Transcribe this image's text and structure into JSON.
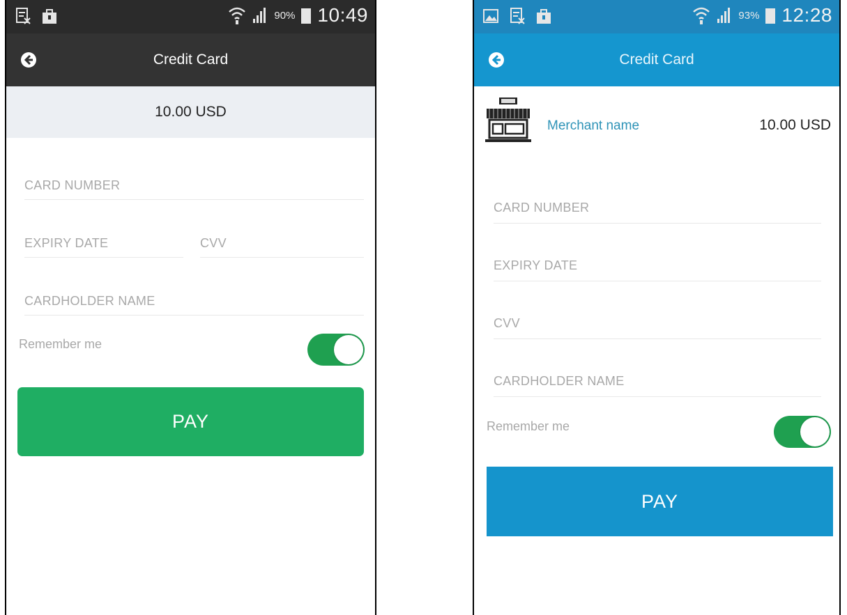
{
  "screen_left": {
    "status": {
      "battery_pct": "90%",
      "time": "10:49"
    },
    "appbar_title": "Credit Card",
    "amount": "10.00 USD",
    "fields": {
      "card_number": "CARD NUMBER",
      "expiry_date": "EXPIRY DATE",
      "cvv": "CVV",
      "cardholder_name": "CARDHOLDER NAME"
    },
    "remember_label": "Remember me",
    "remember_on": true,
    "pay_label": "PAY",
    "colors": {
      "appbar": "#333333",
      "pay": "#1fae63",
      "toggle": "#1fa050"
    }
  },
  "screen_right": {
    "status": {
      "battery_pct": "93%",
      "time": "12:28"
    },
    "appbar_title": "Credit Card",
    "merchant_name": "Merchant name",
    "amount": "10.00 USD",
    "fields": {
      "card_number": "CARD NUMBER",
      "expiry_date": "EXPIRY DATE",
      "cvv": "CVV",
      "cardholder_name": "CARDHOLDER NAME"
    },
    "remember_label": "Remember me",
    "remember_on": true,
    "pay_label": "PAY",
    "colors": {
      "appbar": "#1596cf",
      "pay": "#1594cc",
      "toggle": "#1fa050"
    }
  }
}
